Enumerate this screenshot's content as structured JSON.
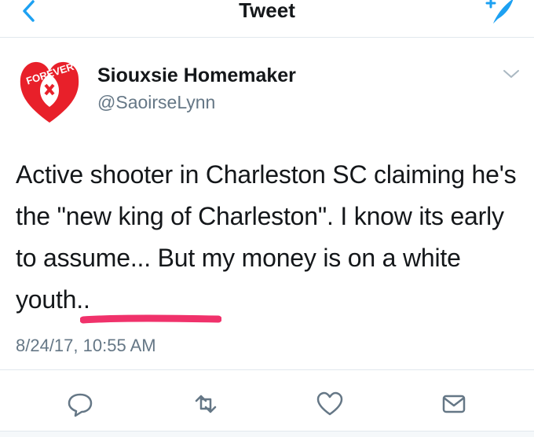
{
  "nav": {
    "title": "Tweet",
    "back_icon": "chevron-left-icon",
    "compose_icon": "compose-tweet-icon"
  },
  "author": {
    "display_name": "Siouxsie Homemaker",
    "handle": "@SaoirseLynn",
    "avatar_text": "FOREVER"
  },
  "tweet": {
    "text": "Active shooter in Charleston SC claiming he's the \"new king of Charleston\". I know its early to assume... But my money is on a white youth..",
    "timestamp": "8/24/17, 10:55 AM",
    "highlight_color": "#f0326b"
  },
  "actions": [
    "reply-icon",
    "retweet-icon",
    "like-icon",
    "share-icon"
  ],
  "colors": {
    "accent": "#1da1f2",
    "text": "#14171a",
    "secondary_text": "#657786",
    "avatar_red": "#e8202a"
  }
}
